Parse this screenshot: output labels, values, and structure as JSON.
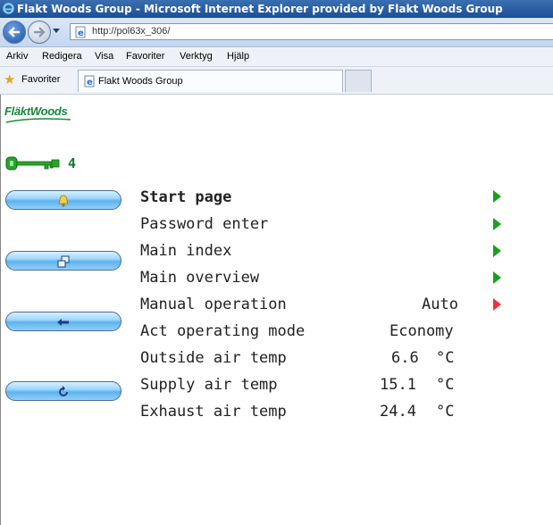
{
  "window": {
    "title": "Flakt Woods Group - Microsoft Internet Explorer provided by Flakt Woods Group"
  },
  "address": {
    "url": "http://pol63x_306/"
  },
  "menu": [
    "Arkiv",
    "Redigera",
    "Visa",
    "Favoriter",
    "Verktyg",
    "Hjälp"
  ],
  "favorites": {
    "label": "Favoriter"
  },
  "tab": {
    "title": "Flakt Woods Group"
  },
  "logo": {
    "text": "FläktWoods"
  },
  "access": {
    "level": "4"
  },
  "side_buttons": [
    {
      "name": "alarm-button",
      "icon": "bell-icon"
    },
    {
      "name": "windows-button",
      "icon": "windows-icon"
    },
    {
      "name": "back-button",
      "icon": "arrow-left-icon"
    },
    {
      "name": "refresh-button",
      "icon": "refresh-icon"
    }
  ],
  "rows": [
    {
      "label": "Start page",
      "value": "",
      "unit": "",
      "arrow": "green",
      "bold": true
    },
    {
      "label": "Password enter",
      "value": "",
      "unit": "",
      "arrow": "green"
    },
    {
      "label": "Main index",
      "value": "",
      "unit": "",
      "arrow": "green"
    },
    {
      "label": "Main overview",
      "value": "",
      "unit": "",
      "arrow": "green"
    },
    {
      "label": "Manual operation",
      "value": "Auto",
      "unit": "",
      "arrow": "red"
    },
    {
      "label": "Act operating mode",
      "value": "Economy",
      "unit": "",
      "arrow": ""
    },
    {
      "label": "Outside air temp",
      "value": "6.6",
      "unit": "°C",
      "arrow": ""
    },
    {
      "label": "Supply air temp",
      "value": "15.1",
      "unit": "°C",
      "arrow": ""
    },
    {
      "label": "Exhaust air temp",
      "value": "24.4",
      "unit": "°C",
      "arrow": ""
    }
  ],
  "colors": {
    "accent_green": "#17a11d",
    "arrow_red": "#e6333d",
    "button_blue": "#5fb2ec"
  }
}
